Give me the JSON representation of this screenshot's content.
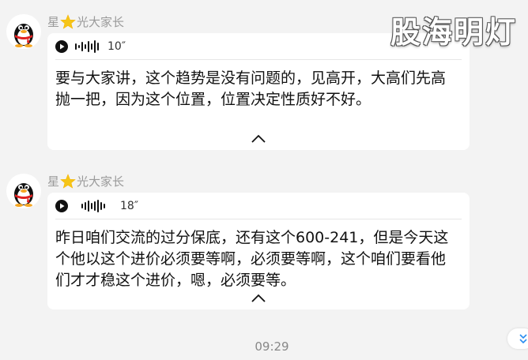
{
  "watermark": "股海明灯",
  "messages": [
    {
      "sender_prefix": "星",
      "sender_suffix": "光大家长",
      "duration": "10″",
      "text": "要与大家讲，这个趋势是没有问题的，见高开，大高们先高抛一把，因为这个位置，位置决定性质好不好。"
    },
    {
      "sender_prefix": "星",
      "sender_suffix": "光大家长",
      "duration": "18″",
      "text": "昨日咱们交流的过分保底，还有这个600-241，但是今天这个他以这个进价必须要等啊，必须要等啊，这个咱们要看他们才才稳这个进价，嗯，必须要等。"
    }
  ],
  "timestamp": "09:29",
  "colors": {
    "background": "#f3f3f3",
    "bubble": "#ffffff",
    "sender": "#9a9a9a",
    "star": "#f5c518"
  }
}
